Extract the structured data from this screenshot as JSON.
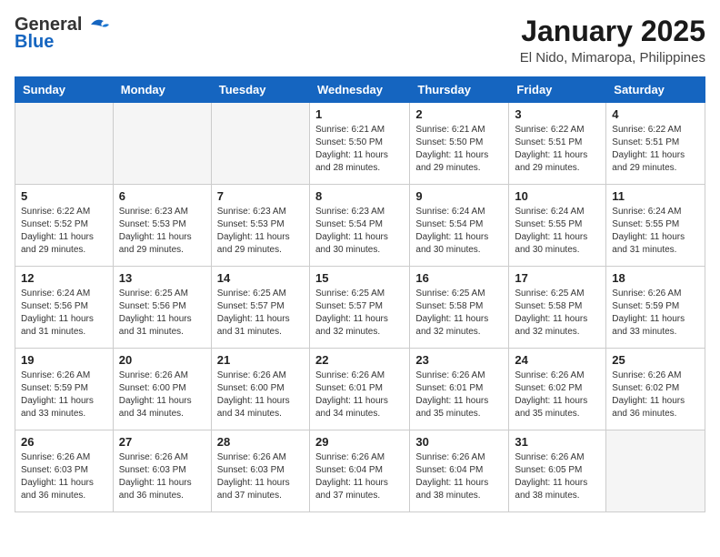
{
  "header": {
    "logo_general": "General",
    "logo_blue": "Blue",
    "month": "January 2025",
    "location": "El Nido, Mimaropa, Philippines"
  },
  "weekdays": [
    "Sunday",
    "Monday",
    "Tuesday",
    "Wednesday",
    "Thursday",
    "Friday",
    "Saturday"
  ],
  "weeks": [
    [
      {
        "day": "",
        "content": ""
      },
      {
        "day": "",
        "content": ""
      },
      {
        "day": "",
        "content": ""
      },
      {
        "day": "1",
        "content": "Sunrise: 6:21 AM\nSunset: 5:50 PM\nDaylight: 11 hours and 28 minutes."
      },
      {
        "day": "2",
        "content": "Sunrise: 6:21 AM\nSunset: 5:50 PM\nDaylight: 11 hours and 29 minutes."
      },
      {
        "day": "3",
        "content": "Sunrise: 6:22 AM\nSunset: 5:51 PM\nDaylight: 11 hours and 29 minutes."
      },
      {
        "day": "4",
        "content": "Sunrise: 6:22 AM\nSunset: 5:51 PM\nDaylight: 11 hours and 29 minutes."
      }
    ],
    [
      {
        "day": "5",
        "content": "Sunrise: 6:22 AM\nSunset: 5:52 PM\nDaylight: 11 hours and 29 minutes."
      },
      {
        "day": "6",
        "content": "Sunrise: 6:23 AM\nSunset: 5:53 PM\nDaylight: 11 hours and 29 minutes."
      },
      {
        "day": "7",
        "content": "Sunrise: 6:23 AM\nSunset: 5:53 PM\nDaylight: 11 hours and 29 minutes."
      },
      {
        "day": "8",
        "content": "Sunrise: 6:23 AM\nSunset: 5:54 PM\nDaylight: 11 hours and 30 minutes."
      },
      {
        "day": "9",
        "content": "Sunrise: 6:24 AM\nSunset: 5:54 PM\nDaylight: 11 hours and 30 minutes."
      },
      {
        "day": "10",
        "content": "Sunrise: 6:24 AM\nSunset: 5:55 PM\nDaylight: 11 hours and 30 minutes."
      },
      {
        "day": "11",
        "content": "Sunrise: 6:24 AM\nSunset: 5:55 PM\nDaylight: 11 hours and 31 minutes."
      }
    ],
    [
      {
        "day": "12",
        "content": "Sunrise: 6:24 AM\nSunset: 5:56 PM\nDaylight: 11 hours and 31 minutes."
      },
      {
        "day": "13",
        "content": "Sunrise: 6:25 AM\nSunset: 5:56 PM\nDaylight: 11 hours and 31 minutes."
      },
      {
        "day": "14",
        "content": "Sunrise: 6:25 AM\nSunset: 5:57 PM\nDaylight: 11 hours and 31 minutes."
      },
      {
        "day": "15",
        "content": "Sunrise: 6:25 AM\nSunset: 5:57 PM\nDaylight: 11 hours and 32 minutes."
      },
      {
        "day": "16",
        "content": "Sunrise: 6:25 AM\nSunset: 5:58 PM\nDaylight: 11 hours and 32 minutes."
      },
      {
        "day": "17",
        "content": "Sunrise: 6:25 AM\nSunset: 5:58 PM\nDaylight: 11 hours and 32 minutes."
      },
      {
        "day": "18",
        "content": "Sunrise: 6:26 AM\nSunset: 5:59 PM\nDaylight: 11 hours and 33 minutes."
      }
    ],
    [
      {
        "day": "19",
        "content": "Sunrise: 6:26 AM\nSunset: 5:59 PM\nDaylight: 11 hours and 33 minutes."
      },
      {
        "day": "20",
        "content": "Sunrise: 6:26 AM\nSunset: 6:00 PM\nDaylight: 11 hours and 34 minutes."
      },
      {
        "day": "21",
        "content": "Sunrise: 6:26 AM\nSunset: 6:00 PM\nDaylight: 11 hours and 34 minutes."
      },
      {
        "day": "22",
        "content": "Sunrise: 6:26 AM\nSunset: 6:01 PM\nDaylight: 11 hours and 34 minutes."
      },
      {
        "day": "23",
        "content": "Sunrise: 6:26 AM\nSunset: 6:01 PM\nDaylight: 11 hours and 35 minutes."
      },
      {
        "day": "24",
        "content": "Sunrise: 6:26 AM\nSunset: 6:02 PM\nDaylight: 11 hours and 35 minutes."
      },
      {
        "day": "25",
        "content": "Sunrise: 6:26 AM\nSunset: 6:02 PM\nDaylight: 11 hours and 36 minutes."
      }
    ],
    [
      {
        "day": "26",
        "content": "Sunrise: 6:26 AM\nSunset: 6:03 PM\nDaylight: 11 hours and 36 minutes."
      },
      {
        "day": "27",
        "content": "Sunrise: 6:26 AM\nSunset: 6:03 PM\nDaylight: 11 hours and 36 minutes."
      },
      {
        "day": "28",
        "content": "Sunrise: 6:26 AM\nSunset: 6:03 PM\nDaylight: 11 hours and 37 minutes."
      },
      {
        "day": "29",
        "content": "Sunrise: 6:26 AM\nSunset: 6:04 PM\nDaylight: 11 hours and 37 minutes."
      },
      {
        "day": "30",
        "content": "Sunrise: 6:26 AM\nSunset: 6:04 PM\nDaylight: 11 hours and 38 minutes."
      },
      {
        "day": "31",
        "content": "Sunrise: 6:26 AM\nSunset: 6:05 PM\nDaylight: 11 hours and 38 minutes."
      },
      {
        "day": "",
        "content": ""
      }
    ]
  ]
}
